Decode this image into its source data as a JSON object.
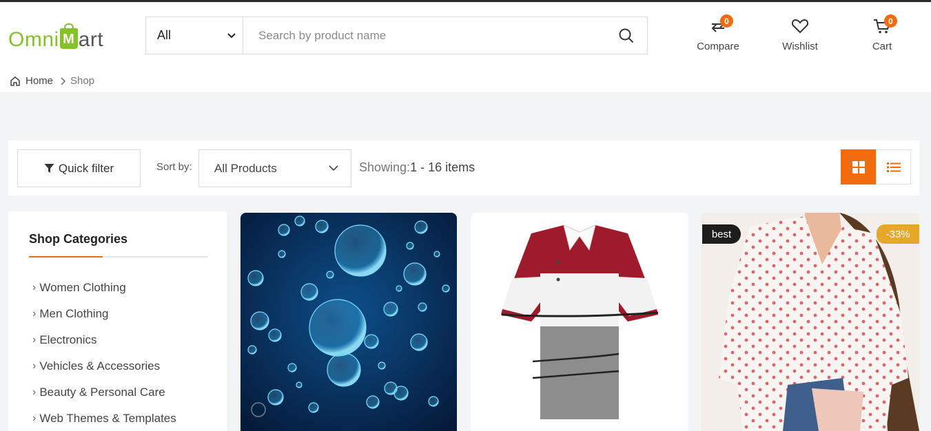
{
  "header": {
    "logo": {
      "part1": "Omni",
      "bag_letter": "M",
      "part2": "art"
    },
    "search": {
      "category": "All",
      "placeholder": "Search by product name"
    },
    "compare": {
      "label": "Compare",
      "count": "0"
    },
    "wishlist": {
      "label": "Wishlist"
    },
    "cart": {
      "label": "Cart",
      "count": "0"
    }
  },
  "breadcrumb": {
    "home": "Home",
    "current": "Shop"
  },
  "toolbar": {
    "quick_filter": "Quick filter",
    "sort_label": "Sort by:",
    "sort_value": "All Products",
    "showing_label": "Showing:",
    "showing_range": "1 - 16 items"
  },
  "sidebar": {
    "title": "Shop Categories",
    "items": [
      {
        "label": "Women Clothing"
      },
      {
        "label": "Men Clothing"
      },
      {
        "label": "Electronics"
      },
      {
        "label": "Vehicles & Accessories"
      },
      {
        "label": "Beauty & Personal Care"
      },
      {
        "label": "Web Themes & Templates"
      }
    ]
  },
  "products": {
    "card3": {
      "tag": "best",
      "discount": "-33%"
    }
  },
  "colors": {
    "accent": "#f26b0f",
    "brand_green": "#84c225",
    "discount": "#e6a82a"
  }
}
